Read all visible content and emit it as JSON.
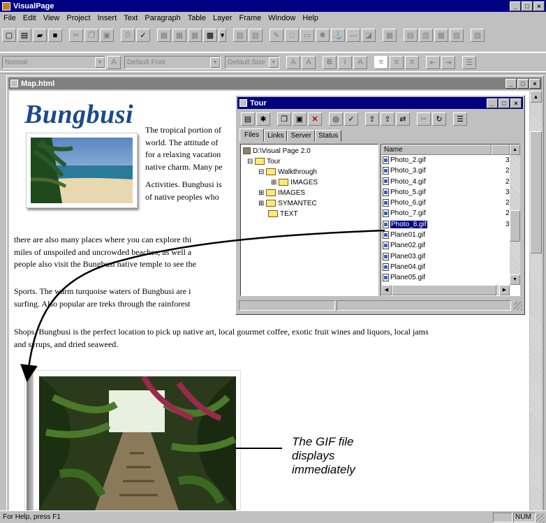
{
  "app": {
    "title": "VisualPage"
  },
  "menu": [
    "File",
    "Edit",
    "View",
    "Project",
    "Insert",
    "Text",
    "Paragraph",
    "Table",
    "Layer",
    "Frame",
    "Window",
    "Help"
  ],
  "format": {
    "style": "Normal",
    "font": "Default Font",
    "size": "Default Size"
  },
  "document": {
    "title": "Map.html",
    "heading": "Bungbusi",
    "lines_right": [
      "The tropical portion of",
      "world. The attitude of",
      "for a relaxing vacation",
      "native charm. Many pe"
    ],
    "lines_activities": [
      "Activities. Bungbusi is",
      "of native peoples who"
    ],
    "lines_full": [
      "there are also many places where you can explore thi",
      "miles of unspoiled and uncrowded beaches, as well a",
      "people also visit the Bungbusi native temple to see the"
    ],
    "sports": [
      "Sports. The warm turquoise waters of Bungbusi are i",
      "surfing. Also popular are treks through the rainforest"
    ],
    "shops": [
      "Shops. Bungbusi is the perfect location to pick up native art, local gourmet coffee, exotic fruit wines and liquors, local jams",
      "and syrups, and dried seaweed."
    ]
  },
  "tour": {
    "title": "Tour",
    "tabs": [
      "Files",
      "Links",
      "Server",
      "Status"
    ],
    "tree": [
      {
        "label": "D:\\Visual Page 2.0",
        "level": 0,
        "icon": "drive"
      },
      {
        "label": "Tour",
        "level": 1,
        "icon": "folder"
      },
      {
        "label": "Walkthrough",
        "level": 2,
        "icon": "folder"
      },
      {
        "label": "IMAGES",
        "level": 3,
        "icon": "folder"
      },
      {
        "label": "IMAGES",
        "level": 2,
        "icon": "folder"
      },
      {
        "label": "SYMANTEC",
        "level": 2,
        "icon": "folder"
      },
      {
        "label": "TEXT",
        "level": 2,
        "icon": "folder"
      }
    ],
    "list_header": "Name",
    "files": [
      {
        "name": "Photo_2.gif",
        "size": "3"
      },
      {
        "name": "Photo_3.gif",
        "size": "2"
      },
      {
        "name": "Photo_4.gif",
        "size": "2"
      },
      {
        "name": "Photo_5.gif",
        "size": "3"
      },
      {
        "name": "Photo_6.gif",
        "size": "2"
      },
      {
        "name": "Photo_7.gif",
        "size": "2"
      },
      {
        "name": "Photo_8.gif",
        "size": "3",
        "selected": true
      },
      {
        "name": "Plane01.gif",
        "size": ""
      },
      {
        "name": "Plane02.gif",
        "size": ""
      },
      {
        "name": "Plane03.gif",
        "size": ""
      },
      {
        "name": "Plane04.gif",
        "size": ""
      },
      {
        "name": "Plane05.gif",
        "size": ""
      }
    ]
  },
  "callout": [
    "The GIF file",
    "displays",
    "immediately"
  ],
  "status": {
    "help": "For Help, press F1",
    "num": "NUM"
  },
  "colors": {
    "title_active": "#000080",
    "chrome": "#c0c0c0",
    "heading": "#1a4a8a",
    "selection": "#000080"
  }
}
